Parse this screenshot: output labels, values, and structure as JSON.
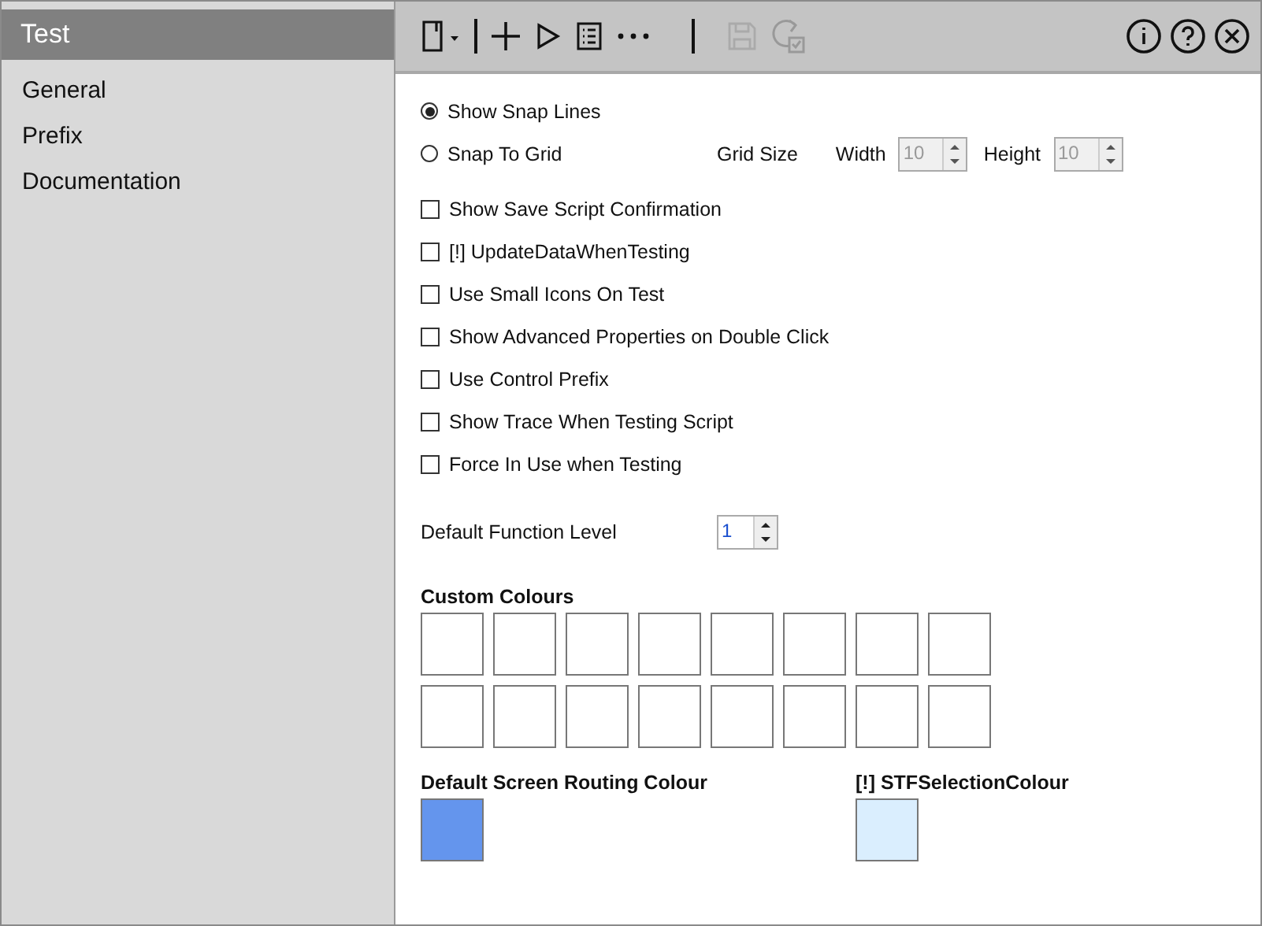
{
  "sidebar": {
    "title": "Test",
    "items": [
      {
        "label": "General",
        "selected": false
      },
      {
        "label": "Prefix",
        "selected": false
      },
      {
        "label": "Documentation",
        "selected": false
      }
    ]
  },
  "toolbar": {
    "left": [
      {
        "kind": "new",
        "disabled": false
      },
      {
        "kind": "separator",
        "disabled": false
      },
      {
        "kind": "add",
        "disabled": false
      },
      {
        "kind": "run",
        "disabled": false
      },
      {
        "kind": "list",
        "disabled": false
      },
      {
        "kind": "more",
        "disabled": false
      },
      {
        "kind": "separator",
        "disabled": false
      },
      {
        "kind": "save",
        "disabled": true
      },
      {
        "kind": "refresh",
        "disabled": true
      }
    ],
    "right": [
      {
        "kind": "info"
      },
      {
        "kind": "help"
      },
      {
        "kind": "close"
      }
    ]
  },
  "snap": [
    {
      "label": "Show Snap Lines",
      "selected": true
    },
    {
      "label": "Snap To Grid",
      "selected": false
    }
  ],
  "grid": {
    "label": "Grid Size",
    "width": {
      "label": "Width",
      "value": "10",
      "disabled": true
    },
    "height": {
      "label": "Height",
      "value": "10",
      "disabled": true
    }
  },
  "options": [
    {
      "label": "Show Save Script Confirmation",
      "checked": false
    },
    {
      "label": "[!] UpdateDataWhenTesting",
      "checked": false
    },
    {
      "label": "Use Small Icons On Test",
      "checked": false
    },
    {
      "label": "Show Advanced Properties on Double Click",
      "checked": false
    },
    {
      "label": "Use Control Prefix",
      "checked": false
    },
    {
      "label": "Show Trace When Testing Script",
      "checked": false
    },
    {
      "label": "Force In Use when Testing",
      "checked": false
    }
  ],
  "function_level": {
    "label": "Default Function Level",
    "value": "1"
  },
  "custom_colours": {
    "title": "Custom Colours",
    "swatches": [
      {
        "color": "#ffffff"
      },
      {
        "color": "#ffffff"
      },
      {
        "color": "#ffffff"
      },
      {
        "color": "#ffffff"
      },
      {
        "color": "#ffffff"
      },
      {
        "color": "#ffffff"
      },
      {
        "color": "#ffffff"
      },
      {
        "color": "#ffffff"
      },
      {
        "color": "#ffffff"
      },
      {
        "color": "#ffffff"
      },
      {
        "color": "#ffffff"
      },
      {
        "color": "#ffffff"
      },
      {
        "color": "#ffffff"
      },
      {
        "color": "#ffffff"
      },
      {
        "color": "#ffffff"
      },
      {
        "color": "#ffffff"
      }
    ]
  },
  "colour_settings": [
    {
      "label": "Default Screen Routing Colour",
      "color": "#6495ed"
    },
    {
      "label": "[!] STFSelectionColour",
      "color": "#daeefe"
    }
  ]
}
